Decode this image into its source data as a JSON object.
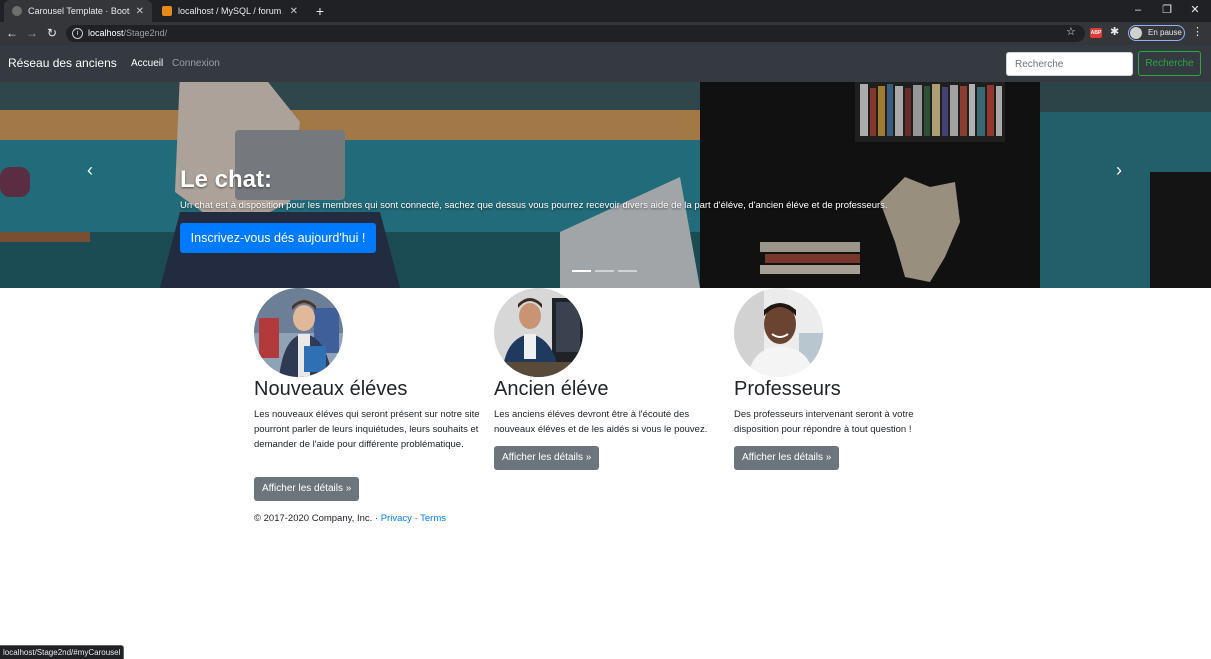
{
  "browser": {
    "tabs": [
      {
        "title": "Carousel Template · Bootstrap",
        "active": true
      },
      {
        "title": "localhost / MySQL / forum / foru",
        "active": false
      }
    ],
    "new_tab": "+",
    "window_controls": {
      "minimize": "–",
      "restore": "❐",
      "close": "✕"
    },
    "address": {
      "host": "localhost",
      "path": "/Stage2nd/"
    },
    "profile_label": "En pause",
    "abp_label": "ABP",
    "status_url": "localhost/Stage2nd/#myCarousel"
  },
  "navbar": {
    "brand": "Réseau des anciens",
    "links": [
      "Accueil",
      "Connexion"
    ],
    "search_placeholder": "Recherche",
    "search_button": "Recherche"
  },
  "carousel": {
    "title": "Le chat:",
    "text": "Un chat est à disposition pour les membres qui sont connecté, sachez que dessus vous pourrez recevoir divers aide de la part d'éléve, d'ancien éléve et de professeurs.",
    "button": "Inscrivez-vous dés aujourd'hui !",
    "active_slide": 1,
    "slide_count": 3
  },
  "columns": [
    {
      "heading": "Nouveaux éléves",
      "text": "Les nouveaux éléves qui seront présent sur notre site pourront parler de leurs inquiétudes, leurs souhaits et demander de l'aide pour différente problématique.",
      "button": "Afficher les détails »"
    },
    {
      "heading": "Ancien éléve",
      "text": "Les anciens éléves devront être à l'écouté des nouveaux éléves et de les aidés si vous le pouvez.",
      "button": "Afficher les détails »"
    },
    {
      "heading": "Professeurs",
      "text": "Des professeurs intervenant seront à votre disposition pour répondre à tout question !",
      "button": "Afficher les détails »"
    }
  ],
  "footer": {
    "copyright": "© 2017-2020 Company, Inc. · ",
    "privacy": "Privacy",
    "separator": " · ",
    "terms": "Terms"
  },
  "colors": {
    "navbar": "#343a40",
    "primary": "#007bff",
    "success": "#28a745",
    "secondary": "#6c757d"
  }
}
